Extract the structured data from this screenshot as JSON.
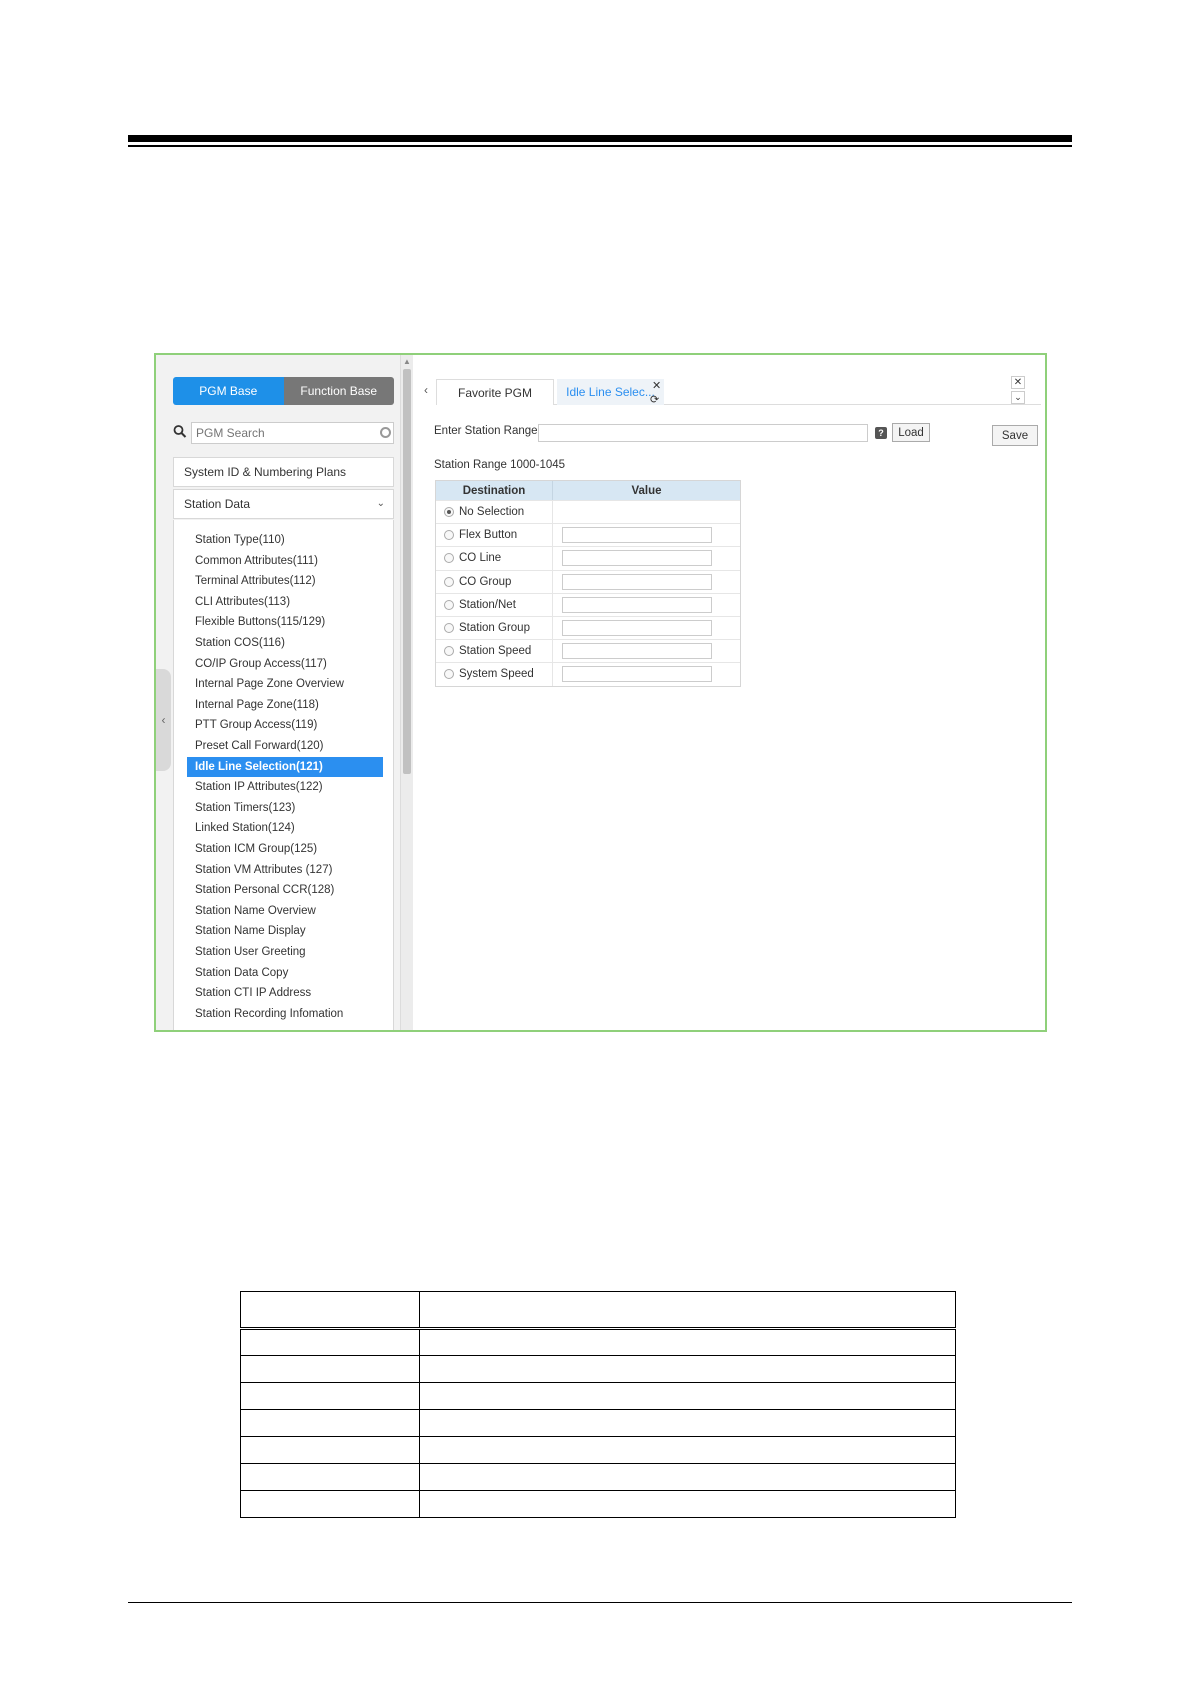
{
  "left_panel": {
    "mode_tabs": [
      "PGM Base",
      "Function Base"
    ],
    "search": {
      "placeholder": "PGM Search"
    },
    "groups": [
      "System ID & Numbering Plans",
      "Station Data"
    ],
    "menu_items": [
      "Station Type(110)",
      "Common Attributes(111)",
      "Terminal Attributes(112)",
      "CLI Attributes(113)",
      "Flexible Buttons(115/129)",
      "Station COS(116)",
      "CO/IP Group Access(117)",
      "Internal Page Zone Overview",
      "Internal Page Zone(118)",
      "PTT Group Access(119)",
      "Preset Call Forward(120)",
      "Idle Line Selection(121)",
      "Station IP Attributes(122)",
      "Station Timers(123)",
      "Linked Station(124)",
      "Station ICM Group(125)",
      "Station VM Attributes (127)",
      "Station Personal CCR(128)",
      "Station Name Overview",
      "Station Name Display",
      "Station User Greeting",
      "Station Data Copy",
      "Station CTI IP Address",
      "Station Recording Infomation"
    ],
    "selected_item": "Idle Line Selection(121)"
  },
  "right_panel": {
    "tabs": [
      "Favorite PGM",
      "Idle Line Selec..."
    ],
    "range_label": "Enter Station Range :",
    "range_value": "",
    "help_label": "?",
    "load_label": "Load",
    "save_label": "Save",
    "range_info": "Station Range 1000-1045",
    "table": {
      "headers": [
        "Destination",
        "Value"
      ],
      "rows": [
        {
          "label": "No Selection",
          "checked": true,
          "has_input": false
        },
        {
          "label": "Flex Button",
          "checked": false,
          "has_input": true
        },
        {
          "label": "CO Line",
          "checked": false,
          "has_input": true
        },
        {
          "label": "CO Group",
          "checked": false,
          "has_input": true
        },
        {
          "label": "Station/Net",
          "checked": false,
          "has_input": true
        },
        {
          "label": "Station Group",
          "checked": false,
          "has_input": true
        },
        {
          "label": "Station Speed",
          "checked": false,
          "has_input": true
        },
        {
          "label": "System Speed",
          "checked": false,
          "has_input": true
        }
      ]
    }
  },
  "colors": {
    "accent": "#1e90e8",
    "selected": "#2b8ff0",
    "frame_border": "#8fd07a",
    "table_header": "#d7e7f3"
  }
}
